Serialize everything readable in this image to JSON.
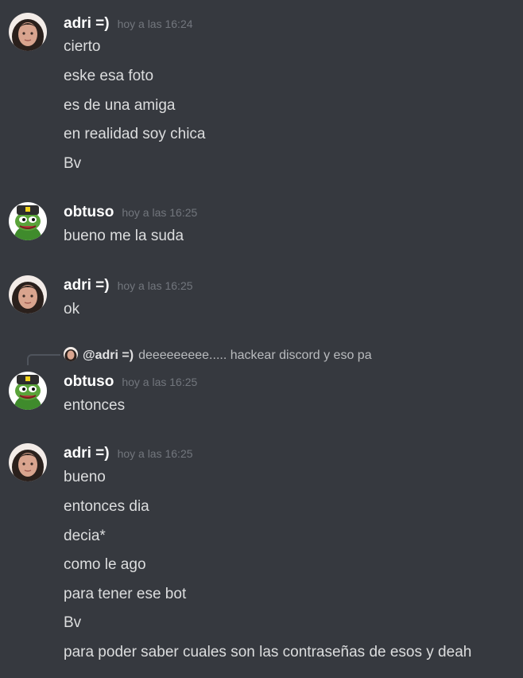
{
  "channel": {
    "messages": [
      {
        "author": "adri =)",
        "timestamp": "hoy a las 16:24",
        "avatar": "girl-avatar",
        "lines": [
          "cierto",
          "eske esa foto",
          "es de una amiga",
          "en realidad soy chica",
          "Bv"
        ]
      },
      {
        "author": "obtuso",
        "timestamp": "hoy a las 16:25",
        "avatar": "pepe-frog-avatar",
        "lines": [
          "bueno me la suda"
        ]
      },
      {
        "author": "adri =)",
        "timestamp": "hoy a las 16:25",
        "avatar": "girl-avatar",
        "lines": [
          "ok"
        ]
      },
      {
        "reply": {
          "author": "@adri =)",
          "text": "deeeeeeeee..... hackear discord y eso pa"
        },
        "author": "obtuso",
        "timestamp": "hoy a las 16:25",
        "avatar": "pepe-frog-avatar",
        "lines": [
          "entonces"
        ]
      },
      {
        "author": "adri =)",
        "timestamp": "hoy a las 16:25",
        "avatar": "girl-avatar",
        "lines": [
          "bueno",
          "entonces dia",
          "decia*",
          "como le ago",
          "para tener ese bot",
          "Bv",
          "para poder saber cuales son las contraseñas de esos y deah"
        ]
      }
    ]
  },
  "colors": {
    "background": "#36393f",
    "username": "#ffffff",
    "text": "#dcddde",
    "timestamp": "#72767d"
  }
}
